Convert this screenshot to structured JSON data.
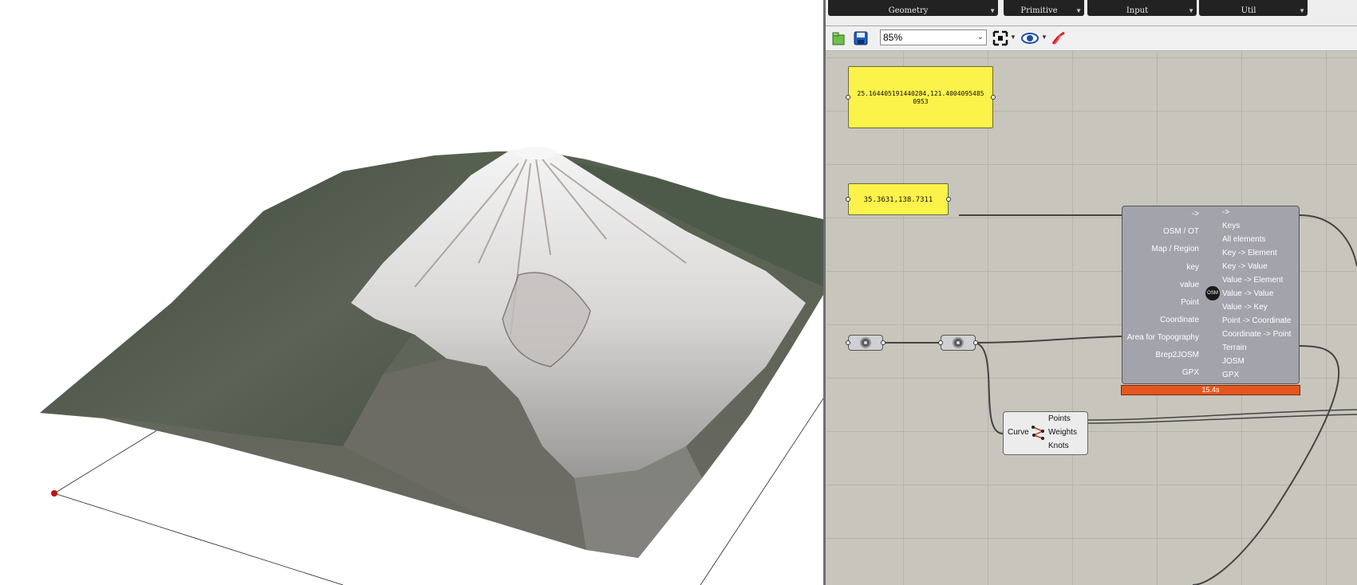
{
  "ribbon": {
    "groups": [
      {
        "label": "Geometry"
      },
      {
        "label": "Primitive"
      },
      {
        "label": "Input"
      },
      {
        "label": "Util"
      }
    ]
  },
  "toolbar": {
    "zoom_value": "85%"
  },
  "canvas": {
    "panel_coords_1": "25.164405191440284,121.4004095485 0953",
    "panel_coords_2": "35.3631,138.7311",
    "component": {
      "inputs": [
        "->",
        "OSM / OT",
        "Map / Region",
        "key",
        "value",
        "Point",
        "Coordinate",
        "Area for Topography",
        "Brep2JOSM",
        "GPX"
      ],
      "outputs": [
        "->",
        "Keys",
        "All elements",
        "Key -> Element",
        "Key -> Value",
        "Value -> Element",
        "Value -> Value",
        "Value -> Key",
        "Point -> Coordinate",
        "Coordinate -> Point",
        "Terrain",
        "JOSM",
        "GPX"
      ],
      "timer": "15.4s"
    },
    "curve_component": {
      "input": "Curve",
      "outputs": [
        "Points",
        "Weights",
        "Knots"
      ]
    }
  },
  "colors": {
    "panel_yellow": "#fbf24a",
    "timer_orange": "#e4561f",
    "canvas_bg": "#c8c5bc",
    "component_gray": "#a3a3ab"
  },
  "icons": {
    "open": "open-file-icon",
    "save": "save-icon",
    "zoom_extents": "zoom-extents-icon",
    "preview": "eye-icon",
    "sketch": "sketch-pen-icon"
  }
}
